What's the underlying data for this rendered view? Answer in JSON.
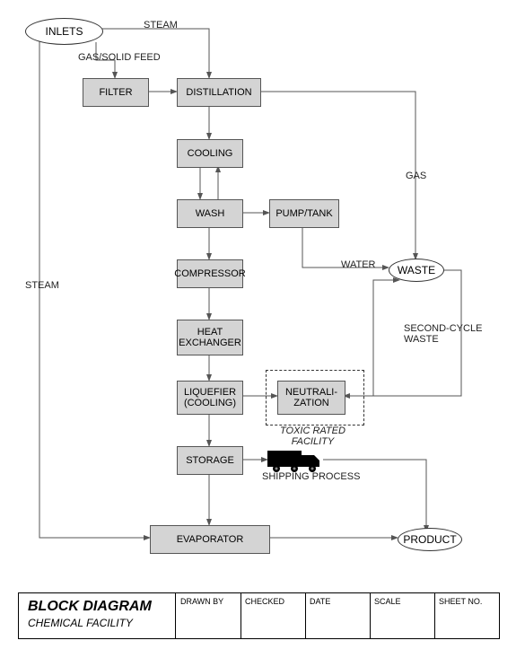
{
  "chart_data": {
    "type": "block-diagram",
    "title": "BLOCK DIAGRAM — CHEMICAL FACILITY",
    "nodes": [
      {
        "id": "inlets",
        "label": "INLETS",
        "shape": "ellipse"
      },
      {
        "id": "filter",
        "label": "FILTER",
        "shape": "rect"
      },
      {
        "id": "distillation",
        "label": "DISTILLATION",
        "shape": "rect"
      },
      {
        "id": "cooling",
        "label": "COOLING",
        "shape": "rect"
      },
      {
        "id": "wash",
        "label": "WASH",
        "shape": "rect"
      },
      {
        "id": "pumptank",
        "label": "PUMP/TANK",
        "shape": "rect"
      },
      {
        "id": "compressor",
        "label": "COMPRESSOR",
        "shape": "rect"
      },
      {
        "id": "heat",
        "label": "HEAT EXCHANGER",
        "shape": "rect"
      },
      {
        "id": "liquefier",
        "label": "LIQUEFIER (COOLING)",
        "shape": "rect"
      },
      {
        "id": "neutralization",
        "label": "NEUTRALIZATION",
        "shape": "rect"
      },
      {
        "id": "storage",
        "label": "STORAGE",
        "shape": "rect"
      },
      {
        "id": "evaporator",
        "label": "EVAPORATOR",
        "shape": "rect"
      },
      {
        "id": "waste",
        "label": "WASTE",
        "shape": "ellipse"
      },
      {
        "id": "product",
        "label": "PRODUCT",
        "shape": "ellipse"
      }
    ],
    "edges": [
      {
        "from": "inlets",
        "to": "distillation",
        "label": "STEAM"
      },
      {
        "from": "inlets",
        "to": "filter",
        "label": "GAS/SOLID FEED"
      },
      {
        "from": "inlets",
        "to": "evaporator",
        "label": "STEAM"
      },
      {
        "from": "filter",
        "to": "distillation"
      },
      {
        "from": "distillation",
        "to": "cooling"
      },
      {
        "from": "distillation",
        "to": "waste",
        "label": "GAS"
      },
      {
        "from": "cooling",
        "to": "wash"
      },
      {
        "from": "wash",
        "to": "cooling"
      },
      {
        "from": "wash",
        "to": "pumptank"
      },
      {
        "from": "wash",
        "to": "compressor"
      },
      {
        "from": "pumptank",
        "to": "waste",
        "label": "WATER"
      },
      {
        "from": "compressor",
        "to": "heat"
      },
      {
        "from": "heat",
        "to": "liquefier"
      },
      {
        "from": "liquefier",
        "to": "neutralization"
      },
      {
        "from": "liquefier",
        "to": "storage"
      },
      {
        "from": "neutralization",
        "to": "waste",
        "label": "SECOND-CYCLE WASTE"
      },
      {
        "from": "waste",
        "to": "neutralization"
      },
      {
        "from": "storage",
        "to": "product",
        "via": "SHIPPING PROCESS"
      },
      {
        "from": "storage",
        "to": "evaporator"
      },
      {
        "from": "evaporator",
        "to": "product"
      }
    ],
    "annotations": [
      {
        "text": "TOXIC RATED FACILITY",
        "target": "neutralization"
      }
    ]
  },
  "labels": {
    "inlets": "INLETS",
    "filter": "FILTER",
    "distillation": "DISTILLATION",
    "cooling": "COOLING",
    "wash": "WASH",
    "pumptank": "PUMP/TANK",
    "compressor": "COMPRESSOR",
    "heat": "HEAT\nEXCHANGER",
    "liquefier": "LIQUEFIER\n(COOLING)",
    "neutralization": "NEUTRALI-\nZATION",
    "storage": "STORAGE",
    "evaporator": "EVAPORATOR",
    "waste": "WASTE",
    "product": "PRODUCT",
    "steam": "STEAM",
    "feed": "GAS/SOLID FEED",
    "gas": "GAS",
    "water": "WATER",
    "secondcycle": "SECOND-CYCLE\nWASTE",
    "toxic": "TOXIC RATED\nFACILITY",
    "shipping": "SHIPPING PROCESS"
  },
  "titleblock": {
    "title": "BLOCK DIAGRAM",
    "subtitle": "CHEMICAL FACILITY",
    "cols": [
      "DRAWN BY",
      "CHECKED",
      "DATE",
      "SCALE",
      "SHEET NO."
    ]
  }
}
